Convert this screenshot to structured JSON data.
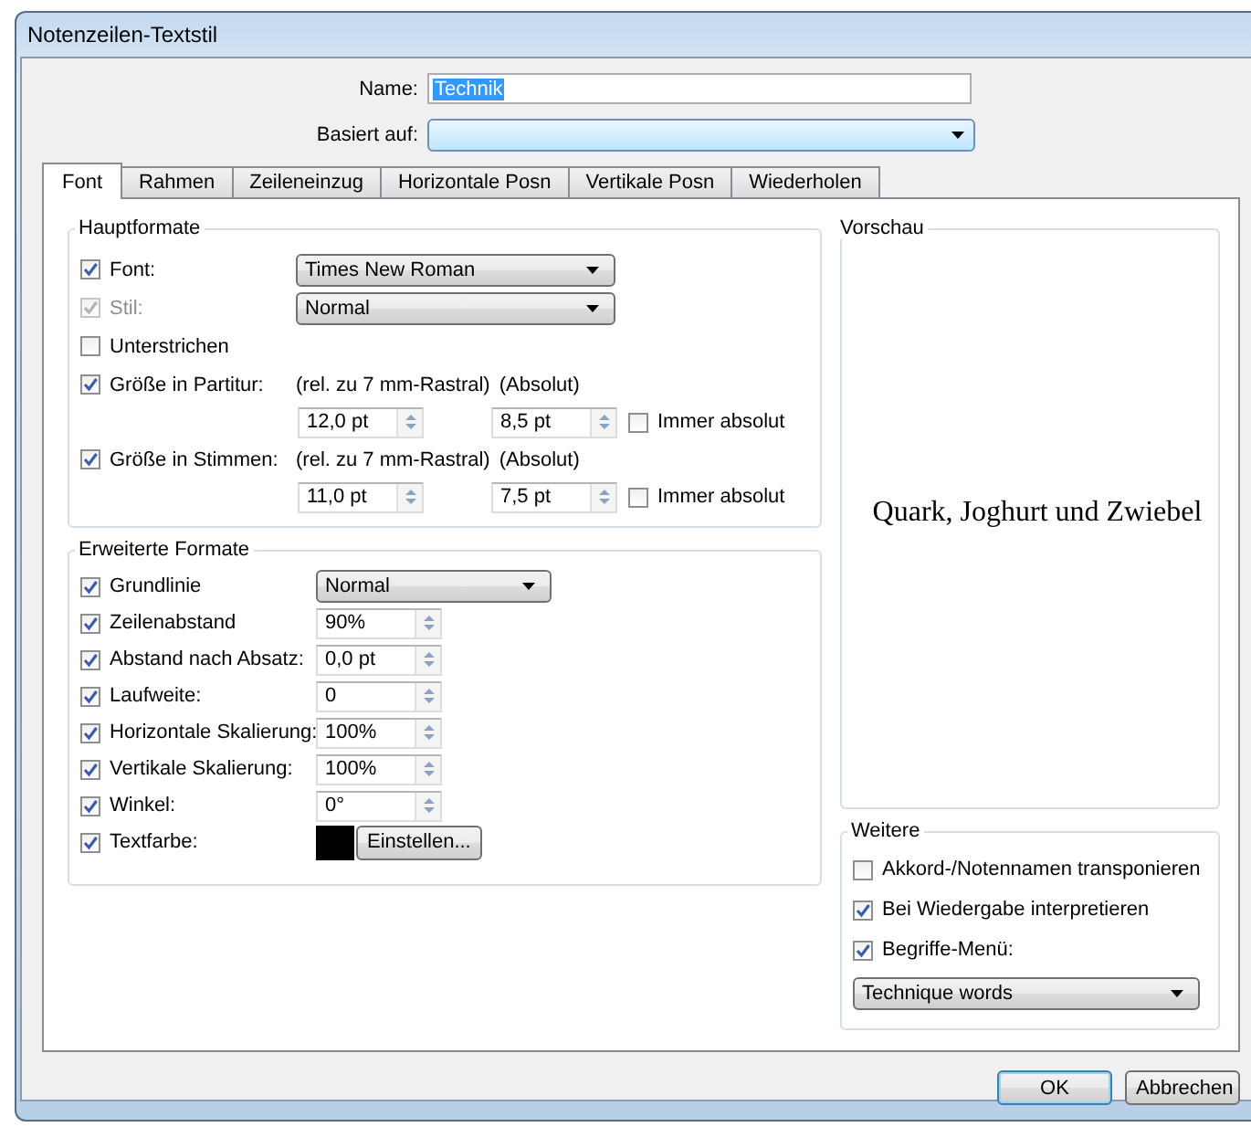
{
  "window": {
    "title": "Notenzeilen-Textstil"
  },
  "name_field": {
    "label": "Name:",
    "value": "Technik"
  },
  "based_on": {
    "label": "Basiert auf:"
  },
  "tabs": [
    {
      "label": "Font",
      "selected": true
    },
    {
      "label": "Rahmen",
      "selected": false
    },
    {
      "label": "Zeileneinzug",
      "selected": false
    },
    {
      "label": "Horizontale Posn",
      "selected": false
    },
    {
      "label": "Vertikale Posn",
      "selected": false
    },
    {
      "label": "Wiederholen",
      "selected": false
    }
  ],
  "hauptformate": {
    "title": "Hauptformate",
    "rows": [
      {
        "kind": "select",
        "label": "Font:",
        "checked": true,
        "disabled": false,
        "value": "Times New Roman"
      },
      {
        "kind": "select",
        "label": "Stil:",
        "checked": true,
        "disabled": true,
        "value": "Normal"
      },
      {
        "kind": "check",
        "label": "Unterstrichen",
        "checked": false
      },
      {
        "kind": "size",
        "label": "Größe in Partitur:",
        "checked": true,
        "rel_label": "(rel. zu 7 mm-Rastral)",
        "abs_label": "(Absolut)",
        "rel_value": "12,0 pt",
        "abs_value": "8,5 pt",
        "always_label": "Immer absolut",
        "always_checked": false
      },
      {
        "kind": "size",
        "label": "Größe in Stimmen:",
        "checked": true,
        "rel_label": "(rel. zu 7 mm-Rastral)",
        "abs_label": "(Absolut)",
        "rel_value": "11,0 pt",
        "abs_value": "7,5 pt",
        "always_label": "Immer absolut",
        "always_checked": false
      }
    ]
  },
  "erweiterte_formate": {
    "title": "Erweiterte Formate",
    "rows": [
      {
        "kind": "select",
        "label": "Grundlinie",
        "checked": true,
        "value": "Normal"
      },
      {
        "kind": "spin",
        "label": "Zeilenabstand",
        "checked": true,
        "value": "90%"
      },
      {
        "kind": "spin",
        "label": "Abstand nach Absatz:",
        "checked": true,
        "value": "0,0 pt"
      },
      {
        "kind": "spin",
        "label": "Laufweite:",
        "checked": true,
        "value": "0"
      },
      {
        "kind": "spin",
        "label": "Horizontale Skalierung:",
        "checked": true,
        "value": "100%"
      },
      {
        "kind": "spin",
        "label": "Vertikale Skalierung:",
        "checked": true,
        "value": "100%"
      },
      {
        "kind": "spin",
        "label": "Winkel:",
        "checked": true,
        "value": "0°"
      },
      {
        "kind": "color",
        "label": "Textfarbe:",
        "checked": true,
        "color": "#000000",
        "button": "Einstellen..."
      }
    ]
  },
  "vorschau": {
    "title": "Vorschau",
    "text": "Quark, Joghurt und Zwiebel"
  },
  "weitere": {
    "title": "Weitere",
    "items": [
      {
        "label": "Akkord-/Notennamen transponieren",
        "checked": false
      },
      {
        "label": "Bei Wiedergabe interpretieren",
        "checked": true
      },
      {
        "label": "Begriffe-Menü:",
        "checked": true
      }
    ],
    "select": "Technique words"
  },
  "buttons": [
    {
      "label": "OK",
      "default": true
    },
    {
      "label": "Abbrechen",
      "default": false
    }
  ]
}
